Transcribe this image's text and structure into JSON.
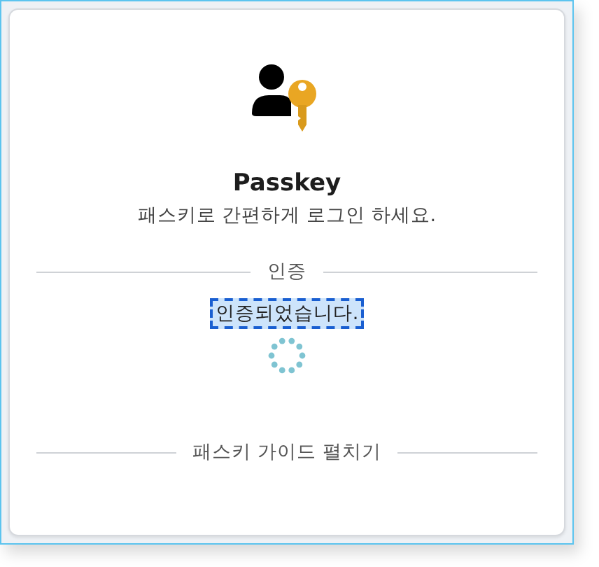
{
  "title": "Passkey",
  "subtitle": "패스키로 간편하게 로그인 하세요.",
  "section_label": "인증",
  "status": {
    "text": "인증되었습니다.",
    "highlighted": true
  },
  "loading": true,
  "guide_toggle": {
    "label": "패스키 가이드 펼치기"
  }
}
